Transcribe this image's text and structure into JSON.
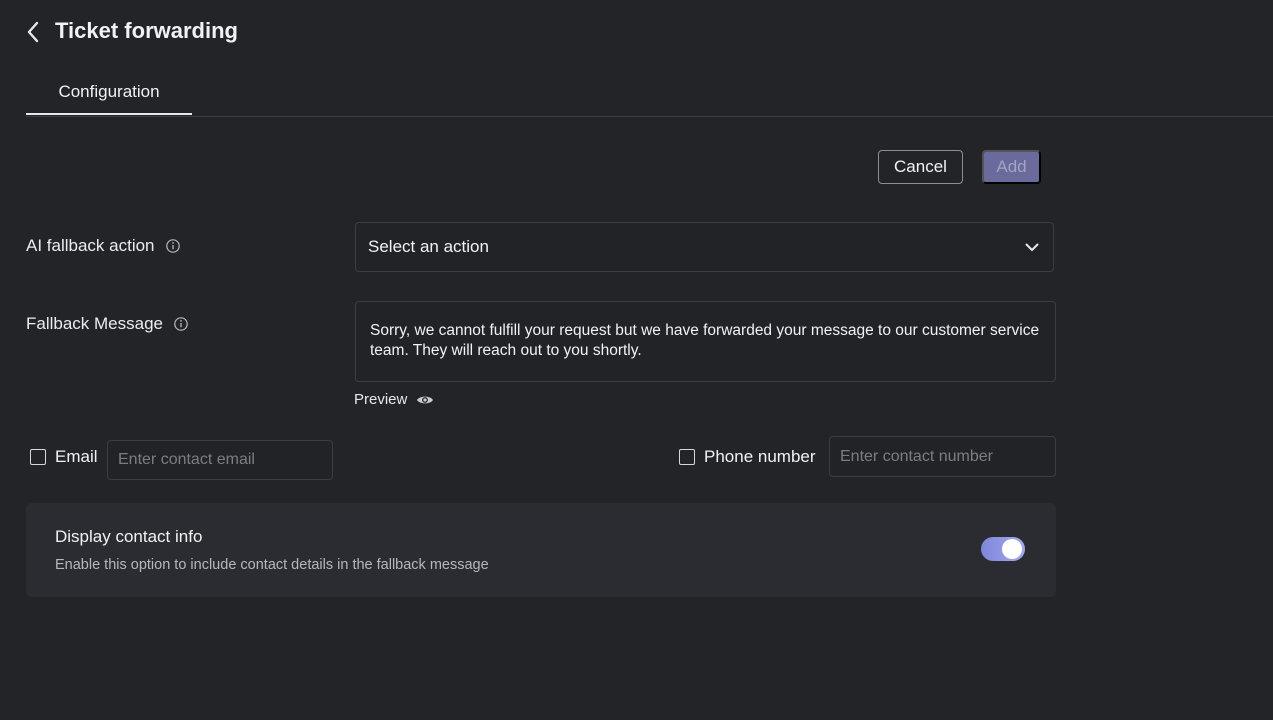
{
  "header": {
    "title": "Ticket forwarding",
    "back_icon": "chevron-left-icon"
  },
  "tabs": [
    {
      "label": "Configuration",
      "active": true
    }
  ],
  "actions": {
    "cancel_label": "Cancel",
    "add_label": "Add",
    "add_enabled": false
  },
  "fallback_action": {
    "label": "AI fallback action",
    "selected_value": "Select an action"
  },
  "fallback_message": {
    "label": "Fallback Message",
    "value": "Sorry, we cannot fulfill your request but we have forwarded your message to our customer service team. They will reach out to you shortly.",
    "preview_label": "Preview"
  },
  "contact": {
    "email_label": "Email",
    "email_checked": false,
    "email_placeholder": "Enter contact email",
    "phone_label": "Phone number",
    "phone_checked": false,
    "phone_placeholder": "Enter contact number"
  },
  "display_contact_info": {
    "title": "Display contact info",
    "description": "Enable this option to include contact details in the fallback message",
    "enabled": true
  },
  "colors": {
    "background": "#232428",
    "card": "#2b2c31",
    "accent": "#8f95e3",
    "add_button": "#6a6a9c"
  }
}
